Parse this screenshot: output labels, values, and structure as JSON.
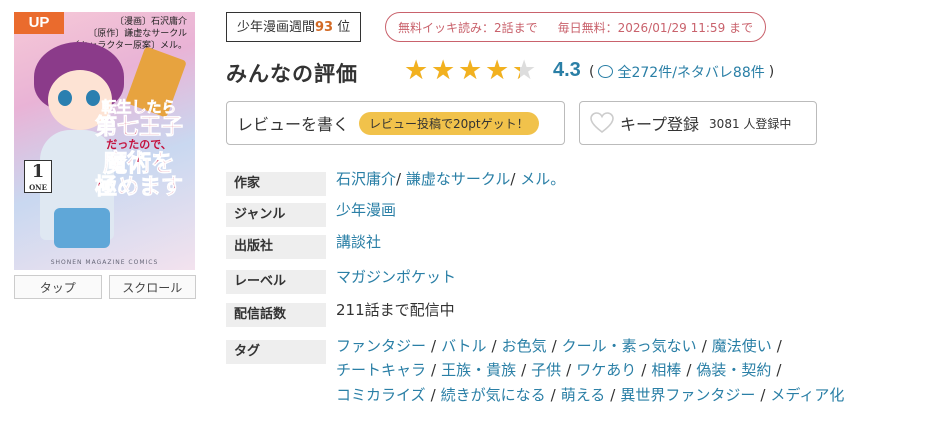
{
  "cover": {
    "badge": "UP",
    "authors": [
      "〔漫画〕石沢庸介",
      "〔原作〕謙虚なサークル",
      "〔キャラクター原案〕メル。"
    ],
    "title_lines": [
      "転生したら",
      "第七王子",
      "だったので、",
      "魔術を",
      "極めます"
    ],
    "volume": "1",
    "volume_sub": "ONE",
    "publisher_line": "SHONEN MAGAZINE COMICS"
  },
  "view_buttons": [
    "タップ",
    "スクロール"
  ],
  "rank": {
    "label": "少年漫画週間",
    "number": "93",
    "suffix": "位"
  },
  "free_info": {
    "left": "無料イッキ読み：2話まで",
    "right": "毎日無料：2026/01/29 11:59 まで"
  },
  "rating": {
    "label": "みんなの評価",
    "score": "4.3",
    "stars_value": 4.3,
    "stars_max": 5,
    "open_paren": "(",
    "counts_text": "全272件/ネタバレ88件",
    "close_paren": ")"
  },
  "review_button": {
    "label": "レビューを書く",
    "points_badge": "レビュー投稿で20ptゲット！"
  },
  "keep_button": {
    "label": "キープ登録",
    "count_text": "3081 人登録中"
  },
  "info": {
    "author": {
      "key": "作家",
      "values": [
        "石沢庸介",
        "謙虚なサークル",
        "メル。"
      ]
    },
    "genre": {
      "key": "ジャンル",
      "value": "少年漫画"
    },
    "publisher": {
      "key": "出版社",
      "value": "講談社"
    },
    "label": {
      "key": "レーベル",
      "value": "マガジンポケット"
    },
    "episodes": {
      "key": "配信話数",
      "value": "211話まで配信中"
    },
    "tags": {
      "key": "タグ",
      "lines": [
        [
          "ファンタジー",
          "バトル",
          "お色気",
          "クール・素っ気ない",
          "魔法使い"
        ],
        [
          "チートキャラ",
          "王族・貴族",
          "子供",
          "ワケあり",
          "相棒",
          "偽装・契約"
        ],
        [
          "コミカライズ",
          "続きが気になる",
          "萌える",
          "異世界ファンタジー",
          "メディア化"
        ]
      ]
    }
  },
  "colors": {
    "accent_link": "#2a7fa6",
    "star": "#f2b11f",
    "badge_orange": "#ea6b2d",
    "free_red": "#c9626c",
    "points_yellow": "#f1c24b"
  }
}
